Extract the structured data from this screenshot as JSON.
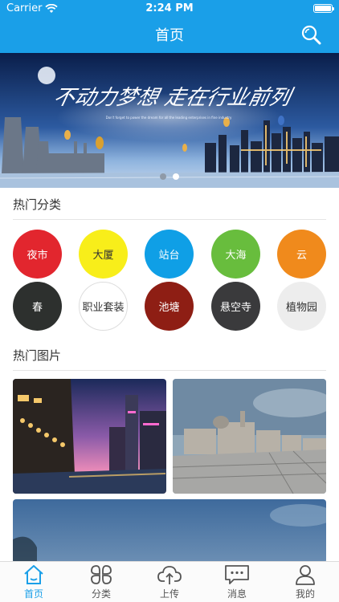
{
  "status_bar": {
    "carrier": "Carrier",
    "time": "2:24 PM"
  },
  "nav": {
    "title": "首页"
  },
  "banner": {
    "slogan": "不动力梦想 走在行业前列",
    "subline": "Don't forget to power the dream for all the leading enterprises in fine industry",
    "page_count": 2,
    "active_page": 2
  },
  "hot_categories": {
    "title": "热门分类",
    "items": [
      {
        "label": "夜市",
        "bg": "#e2262e",
        "fg": "#ffffff"
      },
      {
        "label": "大厦",
        "bg": "#f8ee1a",
        "fg": "#333333"
      },
      {
        "label": "站台",
        "bg": "#0f9fe6",
        "fg": "#ffffff"
      },
      {
        "label": "大海",
        "bg": "#68bd3d",
        "fg": "#ffffff"
      },
      {
        "label": "云",
        "bg": "#f08a1c",
        "fg": "#ffffff"
      },
      {
        "label": "春",
        "bg": "#2d302e",
        "fg": "#ffffff"
      },
      {
        "label": "职业套装",
        "bg": "#ffffff",
        "fg": "#333333"
      },
      {
        "label": "池塘",
        "bg": "#8e1e14",
        "fg": "#ffffff"
      },
      {
        "label": "悬空寺",
        "bg": "#3a3a3c",
        "fg": "#ffffff"
      },
      {
        "label": "植物园",
        "bg": "#ededed",
        "fg": "#333333"
      }
    ]
  },
  "hot_photos": {
    "title": "热门图片"
  },
  "tabs": [
    {
      "label": "首页",
      "active": true
    },
    {
      "label": "分类",
      "active": false
    },
    {
      "label": "上传",
      "active": false
    },
    {
      "label": "消息",
      "active": false
    },
    {
      "label": "我的",
      "active": false
    }
  ],
  "colors": {
    "brand": "#1a9fe8",
    "tab_inactive": "#555555"
  }
}
